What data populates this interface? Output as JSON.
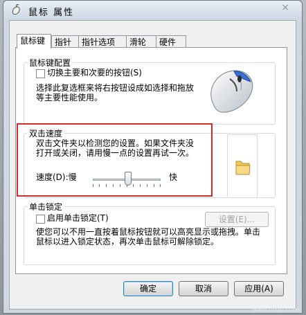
{
  "window": {
    "title": "鼠标 属性",
    "close_glyph": "×"
  },
  "tabs": [
    {
      "label": "鼠标键",
      "active": true
    },
    {
      "label": "指针",
      "active": false
    },
    {
      "label": "指针选项",
      "active": false
    },
    {
      "label": "滑轮",
      "active": false
    },
    {
      "label": "硬件",
      "active": false
    }
  ],
  "button_config": {
    "title": "鼠标键配置",
    "checkbox_label": "切换主要和次要的按钮(S)",
    "checked": false,
    "desc_line1": "选择此复选框来将右按钮设成如选择和拖放",
    "desc_line2": "等主要性能使用。",
    "image_icon": "mouse-image-icon"
  },
  "double_click": {
    "title": "双击速度",
    "desc_line1": "双击文件夹以检测您的设置。如果文件夹没",
    "desc_line2": "打开或关闭，请用慢一点的设置再试一次。",
    "speed_label": "速度(D):慢",
    "fast_label": "快",
    "speed_level_percent": 50,
    "folder_icon": "folder-icon"
  },
  "click_lock": {
    "title": "单击锁定",
    "checkbox_label": "启用单击锁定(T)",
    "checked": false,
    "settings_button": "设置(E)...",
    "desc_line1": "使您可以不用一直按着鼠标按钮就可以高亮显示或拖拽。单击",
    "desc_line2": "鼠标以进入锁定状态，再次单击鼠标可解除锁定。"
  },
  "buttons": {
    "ok": "确定",
    "cancel": "取消",
    "apply": "应用(A)"
  },
  "watermark": "www.dnzp.com",
  "colors": {
    "highlight": "#d62a2a"
  }
}
